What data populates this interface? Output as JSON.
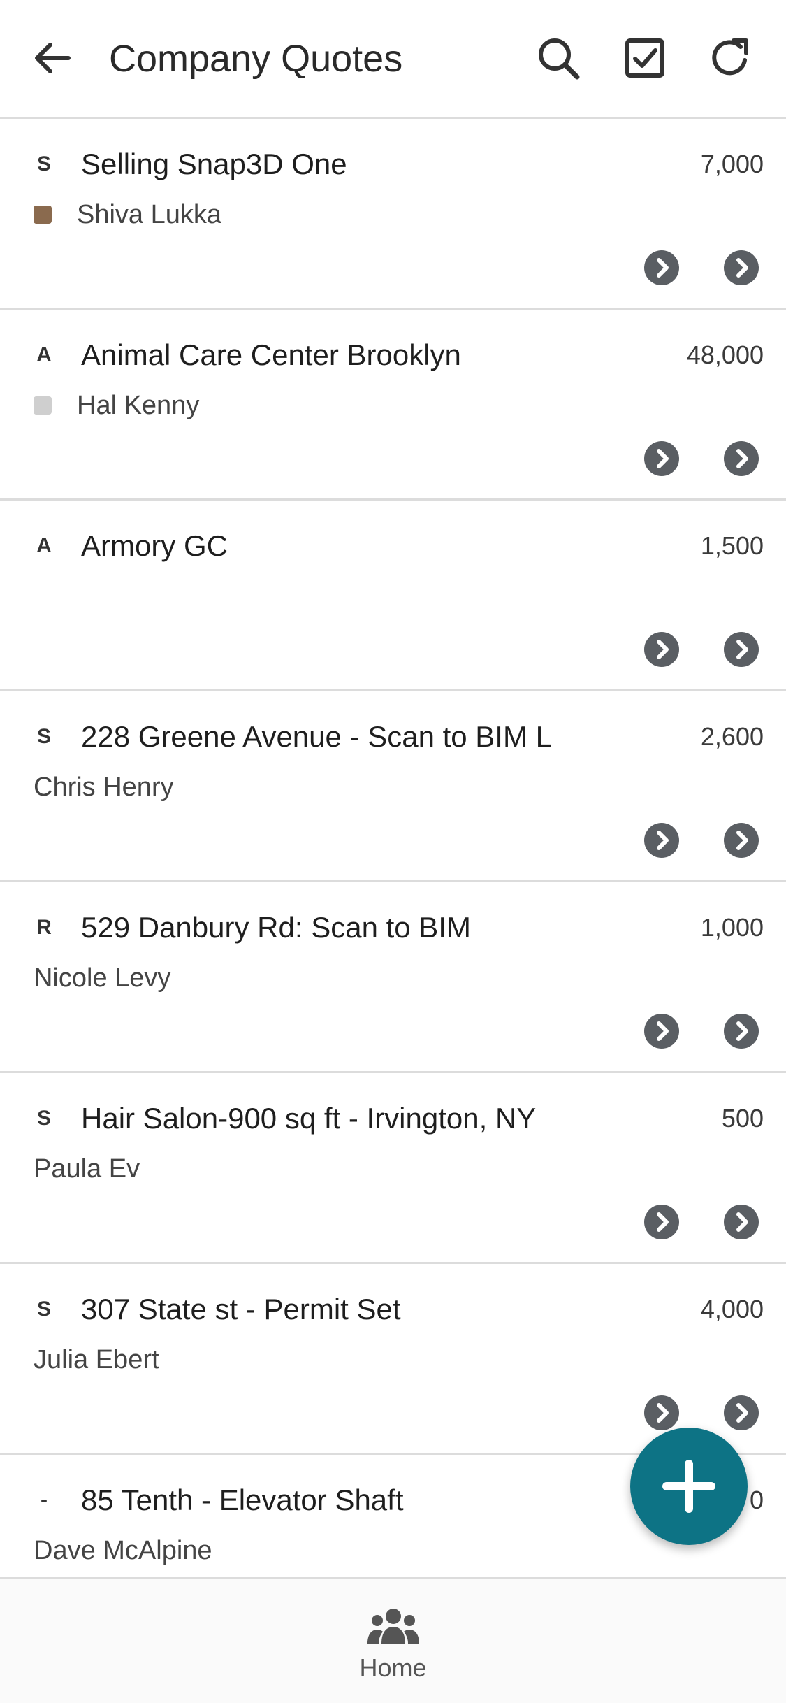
{
  "header": {
    "title": "Company Quotes",
    "back_icon": "arrow-left-icon",
    "actions": [
      "search-icon",
      "checkbox-icon",
      "refresh-icon"
    ]
  },
  "quotes": [
    {
      "logo": "S",
      "name": "Selling Snap3D One",
      "amount": "7,000",
      "contact": "Shiva Lukka",
      "has_avatar": true
    },
    {
      "logo": "A",
      "name": "Animal Care Center Brooklyn",
      "amount": "48,000",
      "contact": "Hal Kenny",
      "has_avatar": true
    },
    {
      "logo": "A",
      "name": "Armory GC",
      "amount": "1,500",
      "contact": "",
      "has_avatar": false
    },
    {
      "logo": "S",
      "name": "228 Greene Avenue - Scan to BIM L",
      "amount": "2,600",
      "contact": "Chris Henry",
      "has_avatar": false
    },
    {
      "logo": "R",
      "name": "529 Danbury Rd: Scan to BIM",
      "amount": "1,000",
      "contact": "Nicole Levy",
      "has_avatar": false
    },
    {
      "logo": "S",
      "name": "Hair Salon-900 sq ft - Irvington, NY",
      "amount": "500",
      "contact": "Paula Ev",
      "has_avatar": false
    },
    {
      "logo": "S",
      "name": "307 State st - Permit Set",
      "amount": "4,000",
      "contact": "Julia Ebert",
      "has_avatar": false
    },
    {
      "logo": "-",
      "name": "85 Tenth - Elevator Shaft",
      "amount": "0",
      "contact": "Dave McAlpine",
      "has_avatar": false
    }
  ],
  "fab": {
    "icon": "plus-icon"
  },
  "bottom_nav": {
    "icon": "people-icon",
    "label": "Home"
  },
  "colors": {
    "accent": "#0d7385",
    "chevron_button": "#5a5e63",
    "divider": "#dcdcdc"
  }
}
